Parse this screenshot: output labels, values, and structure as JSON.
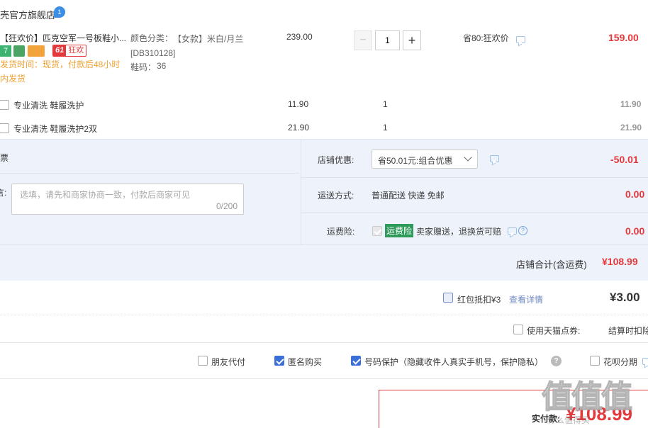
{
  "shop": {
    "name": "壳官方旗舰店",
    "badge": "1"
  },
  "item": {
    "title": "【狂欢价】匹克空军一号板鞋小...",
    "tag_61": "61",
    "tag_kuanghuan": "狂欢",
    "tag_7": "7",
    "delivery": "发货时间：现货，付款后48小时内发货",
    "sku_label": "颜色分类：",
    "sku_value": "【女款】米白/月兰[DB310128]",
    "size_label": "鞋码：",
    "size_value": "36",
    "unit_price": "239.00",
    "quantity": "1",
    "minus": "−",
    "plus": "+",
    "promo": "省80:狂欢价",
    "total": "159.00"
  },
  "services": [
    {
      "name": "专业清洗 鞋履洗护",
      "price": "11.90",
      "qty": "1",
      "total": "11.90"
    },
    {
      "name": "专业清洗 鞋履洗护2双",
      "price": "21.90",
      "qty": "1",
      "total": "21.90"
    }
  ],
  "invoice": {
    "label": "票"
  },
  "message": {
    "label": "言:",
    "placeholder": "选填，请先和商家协商一致，付款后商家可见",
    "count": "0/200"
  },
  "discount": {
    "label": "店铺优惠:",
    "value": "省50.01元:组合优惠",
    "amount": "-50.01"
  },
  "shipping": {
    "label": "运送方式:",
    "value": "普通配送 快递 免邮",
    "amount": "0.00"
  },
  "insurance": {
    "label": "运费险:",
    "badge": "运费险",
    "text": "卖家赠送，退换货可赔",
    "amount": "0.00"
  },
  "shop_total": {
    "label": "店铺合计(含运费)",
    "amount": "¥108.99"
  },
  "redpacket": {
    "label": "红包抵扣¥3",
    "link": "查看详情",
    "amount": "¥3.00"
  },
  "tmall_points": {
    "label": "使用天猫点券:",
    "right": "结算时扣除"
  },
  "options": {
    "friend_pay": "朋友代付",
    "anonymous": "匿名购买",
    "number_protect": "号码保护（隐藏收件人真实手机号，保护隐私）",
    "huabei": "花呗分期"
  },
  "actual_pay": {
    "label": "实付款:",
    "amount": "¥108.99"
  },
  "watermark": {
    "text": "值值值",
    "sub": "什么值得买"
  },
  "colors": {
    "accent": "#e4393c",
    "blue": "#3b6fd8",
    "panel": "#eef3fb"
  }
}
